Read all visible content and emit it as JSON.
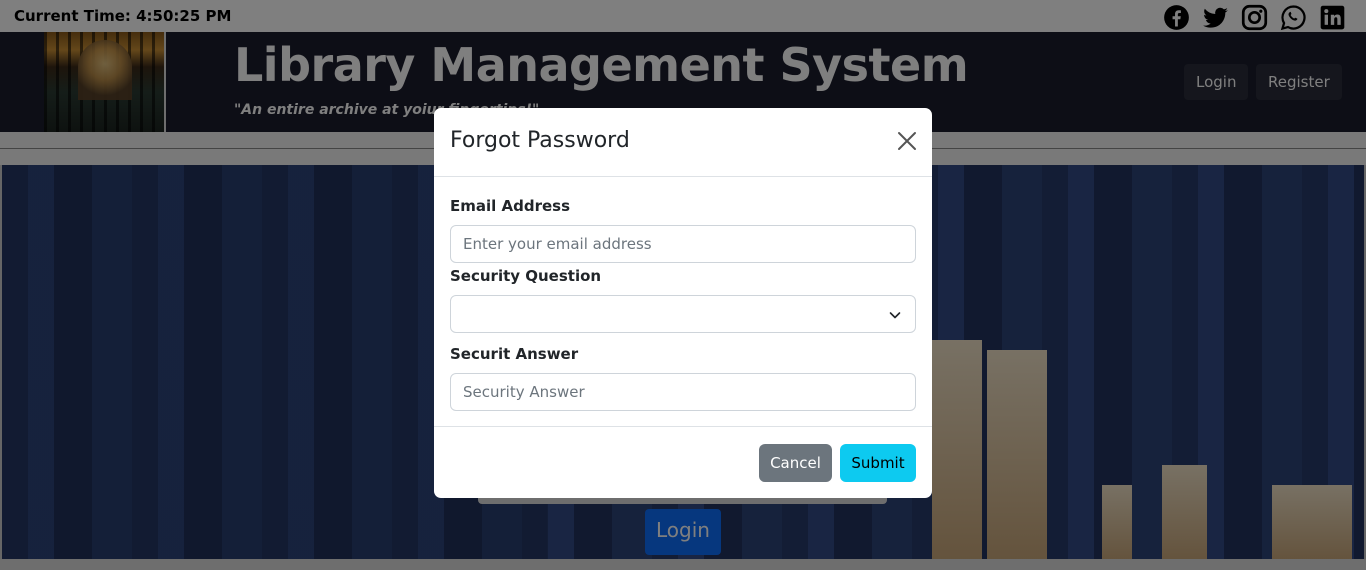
{
  "topbar": {
    "clock_text": "Current Time: 4:50:25 PM",
    "social_icons": [
      "facebook-icon",
      "twitter-icon",
      "instagram-icon",
      "whatsapp-icon",
      "linkedin-icon"
    ]
  },
  "header": {
    "title": "Library Management System",
    "tagline": "\"An entire archive at yoiur fingertips!\"",
    "nav": {
      "login": "Login",
      "register": "Register"
    }
  },
  "hero": {
    "login_button": "Login"
  },
  "modal": {
    "title": "Forgot Password",
    "fields": {
      "email_label": "Email Address",
      "email_placeholder": "Enter your email address",
      "question_label": "Security Question",
      "question_value": "",
      "answer_label": "Securit Answer",
      "answer_placeholder": "Security Answer"
    },
    "buttons": {
      "cancel": "Cancel",
      "submit": "Submit"
    }
  },
  "colors": {
    "header_bg": "#1b1d2c",
    "cancel_bg": "#6c757d",
    "submit_bg": "#0dcaf0",
    "hero_login_bg": "#0d6efd"
  }
}
